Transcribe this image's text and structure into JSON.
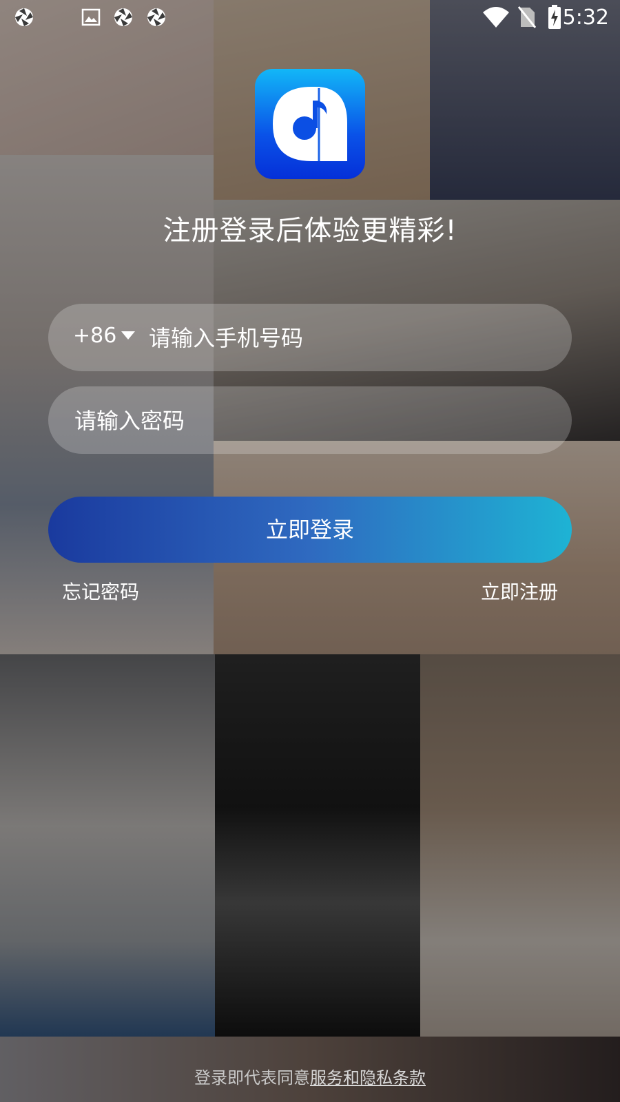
{
  "status_bar": {
    "time": "5:32",
    "left_icons": [
      "aperture-icon",
      "image-icon",
      "aperture-icon",
      "aperture-icon"
    ],
    "right_icons": [
      "wifi-icon",
      "no-sim-icon",
      "battery-charging-icon"
    ]
  },
  "logo": {
    "name": "app-logo-icon"
  },
  "headline": "注册登录后体验更精彩!",
  "phone": {
    "country_code": "+86",
    "placeholder": "请输入手机号码",
    "value": ""
  },
  "password": {
    "placeholder": "请输入密码",
    "value": ""
  },
  "login_button": "立即登录",
  "links": {
    "forgot": "忘记密码",
    "register": "立即注册"
  },
  "agreement": {
    "prefix": "登录即代表同意",
    "link": "服务和隐私条款"
  },
  "colors": {
    "accent_start": "#1a3a9e",
    "accent_end": "#1eb3d4",
    "logo_top": "#12b7f7",
    "logo_bottom": "#0530d8"
  }
}
